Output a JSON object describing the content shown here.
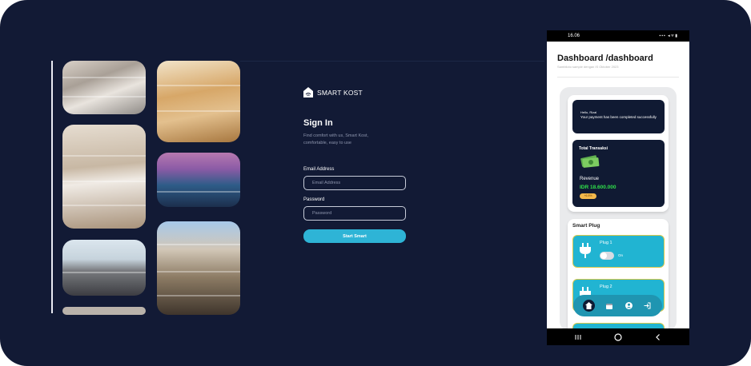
{
  "login": {
    "brand_name": "SMART KOST",
    "title": "Sign In",
    "subtitle": "Find comfort with us, Smart Kost, comfortable, easy to use",
    "email_label": "Email Address",
    "email_placeholder": "Email Address",
    "email_value": "",
    "password_label": "Password",
    "password_placeholder": "Password",
    "password_value": "",
    "submit_label": "Start Smart"
  },
  "phone": {
    "status_time": "16.06",
    "title": "Dashboard /dashboard",
    "subtitle": "Sambiloto sample dengan IS Oktober 2023",
    "notification": {
      "greeting": "Hello, Rizal",
      "message": "Your payment has been completed successfully"
    },
    "transactions": {
      "title": "Total Transaksi",
      "revenue_label": "Revenue",
      "revenue_value": "IDR 18.600.000",
      "badge": "+6.5%"
    },
    "smart_plug": {
      "title": "Smart Plug",
      "plugs": [
        {
          "name": "Plug 1",
          "state": "On"
        },
        {
          "name": "Plug 2",
          "state": ""
        }
      ]
    },
    "nav": [
      "home-icon",
      "calendar-icon",
      "user-icon",
      "logout-icon"
    ]
  },
  "colors": {
    "background": "#121a35",
    "accent": "#2eb4d6",
    "plug_card": "#21b4d2",
    "revenue": "#2fe04a",
    "dark_card": "#101a33"
  }
}
